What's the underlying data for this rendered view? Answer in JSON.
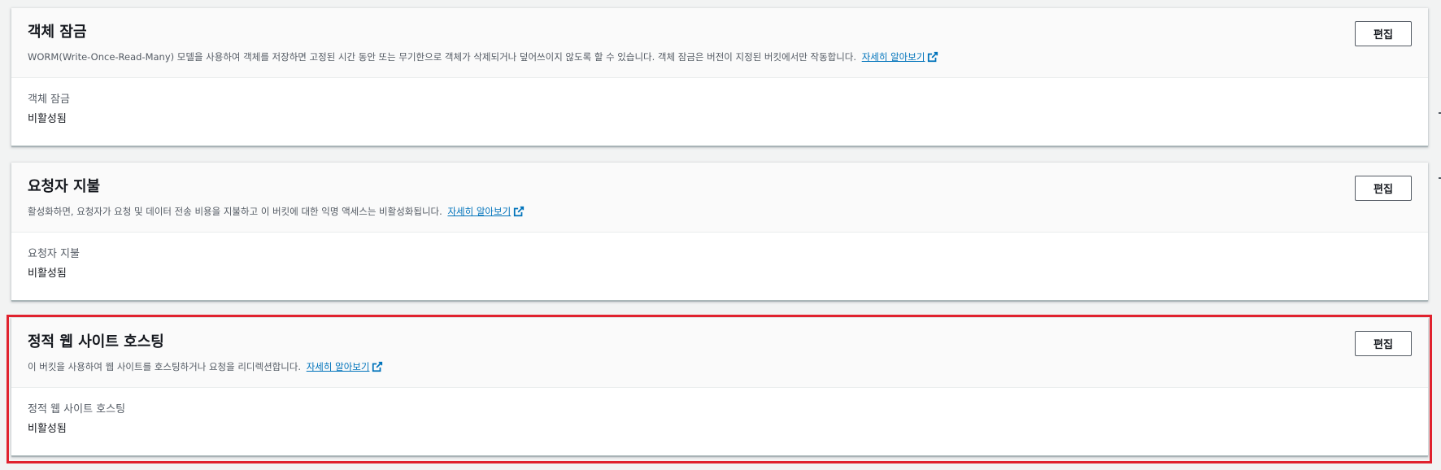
{
  "panels": [
    {
      "title": "객체 잠금",
      "description": "WORM(Write-Once-Read-Many) 모델을 사용하여 객체를 저장하면 고정된 시간 동안 또는 무기한으로 객체가 삭제되거나 덮어쓰이지 않도록 할 수 있습니다. 객체 잠금은 버전이 지정된 버킷에서만 작동합니다.",
      "learn_more": "자세히 알아보기",
      "edit_label": "편집",
      "field_label": "객체 잠금",
      "field_value": "비활성됨"
    },
    {
      "title": "요청자 지불",
      "description": "활성화하면, 요청자가 요청 및 데이터 전송 비용을 지불하고 이 버킷에 대한 익명 액세스는 비활성화됩니다.",
      "learn_more": "자세히 알아보기",
      "edit_label": "편집",
      "field_label": "요청자 지불",
      "field_value": "비활성됨"
    },
    {
      "title": "정적 웹 사이트 호스팅",
      "description": "이 버킷을 사용하여 웹 사이트를 호스팅하거나 요청을 리디렉션합니다.",
      "learn_more": "자세히 알아보기",
      "edit_label": "편집",
      "field_label": "정적 웹 사이트 호스팅",
      "field_value": "비활성됨"
    }
  ],
  "icons": {
    "external_link": "external-link-icon"
  },
  "colors": {
    "link": "#0073bb",
    "highlight_border": "#e0222e",
    "header_bg": "#fafafa",
    "page_bg": "#f2f3f3"
  }
}
